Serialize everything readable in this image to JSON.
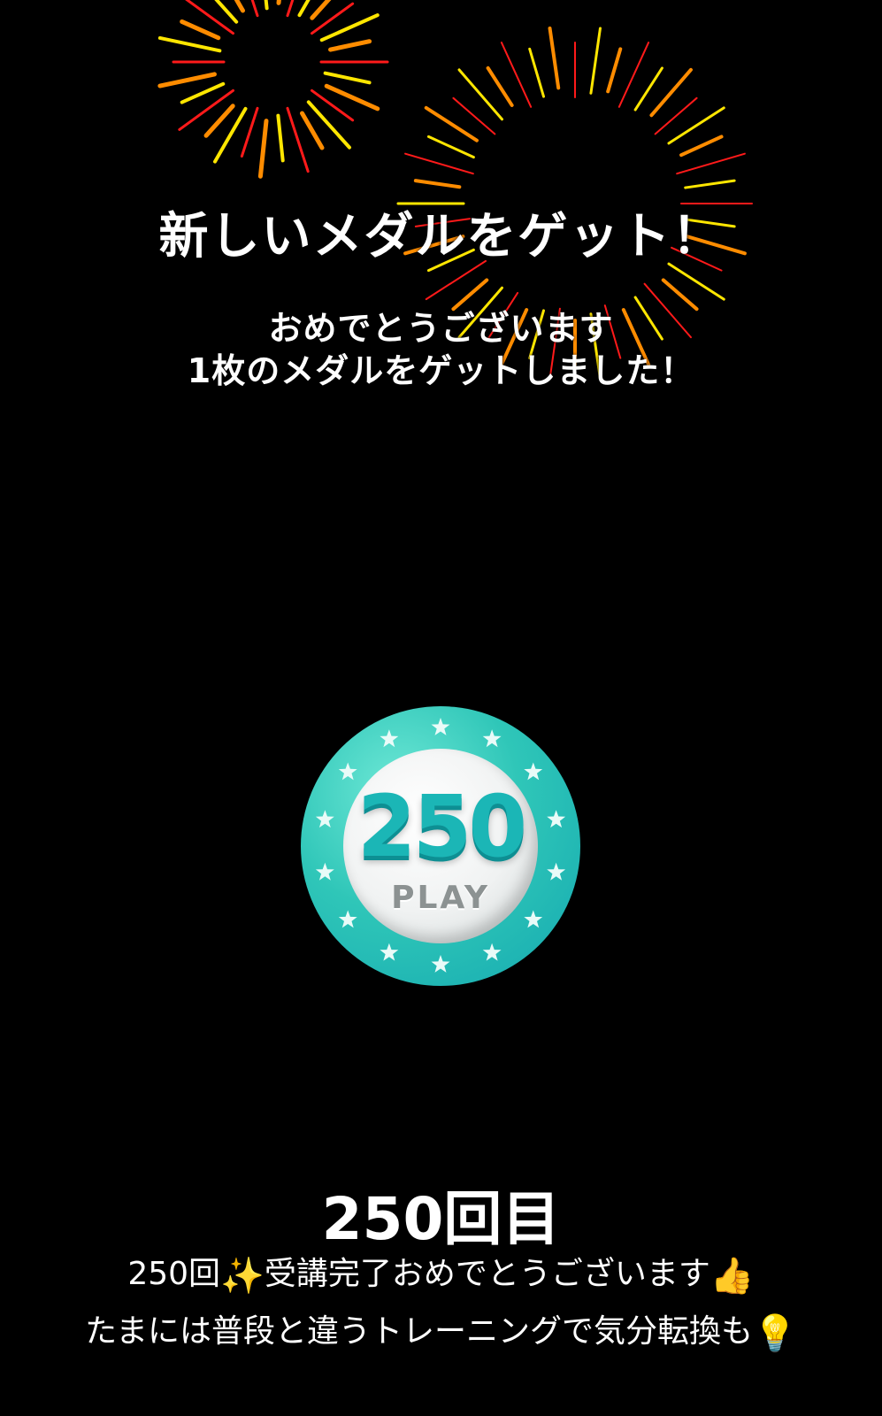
{
  "header": {
    "title": "新しいメダルをゲット！",
    "subtitle_line1": "おめでとうございます",
    "subtitle_line2": "1枚のメダルをゲットしました！"
  },
  "medal": {
    "number": "250",
    "label": "PLAY",
    "colors": {
      "ring": "#2fc6b8",
      "number": "#1bb6b6",
      "label": "#8c9292"
    }
  },
  "footer": {
    "count_title": "250回目",
    "message_line1_text": "250回",
    "message_line1_emoji1": "✨",
    "message_line1_rest": "受講完了おめでとうございます",
    "message_line1_emoji2": "👍",
    "message_line2_text": "たまには普段と違うトレーニングで気分転換も",
    "message_line2_emoji": "💡"
  },
  "icons": {
    "sparkles": "sparkles-icon",
    "thumbs_up": "thumbs-up-icon",
    "light_bulb": "light-bulb-icon"
  },
  "background": {
    "color": "#000000",
    "firework_colors": [
      "#ff1a1a",
      "#ffe600",
      "#ff8c00"
    ]
  }
}
